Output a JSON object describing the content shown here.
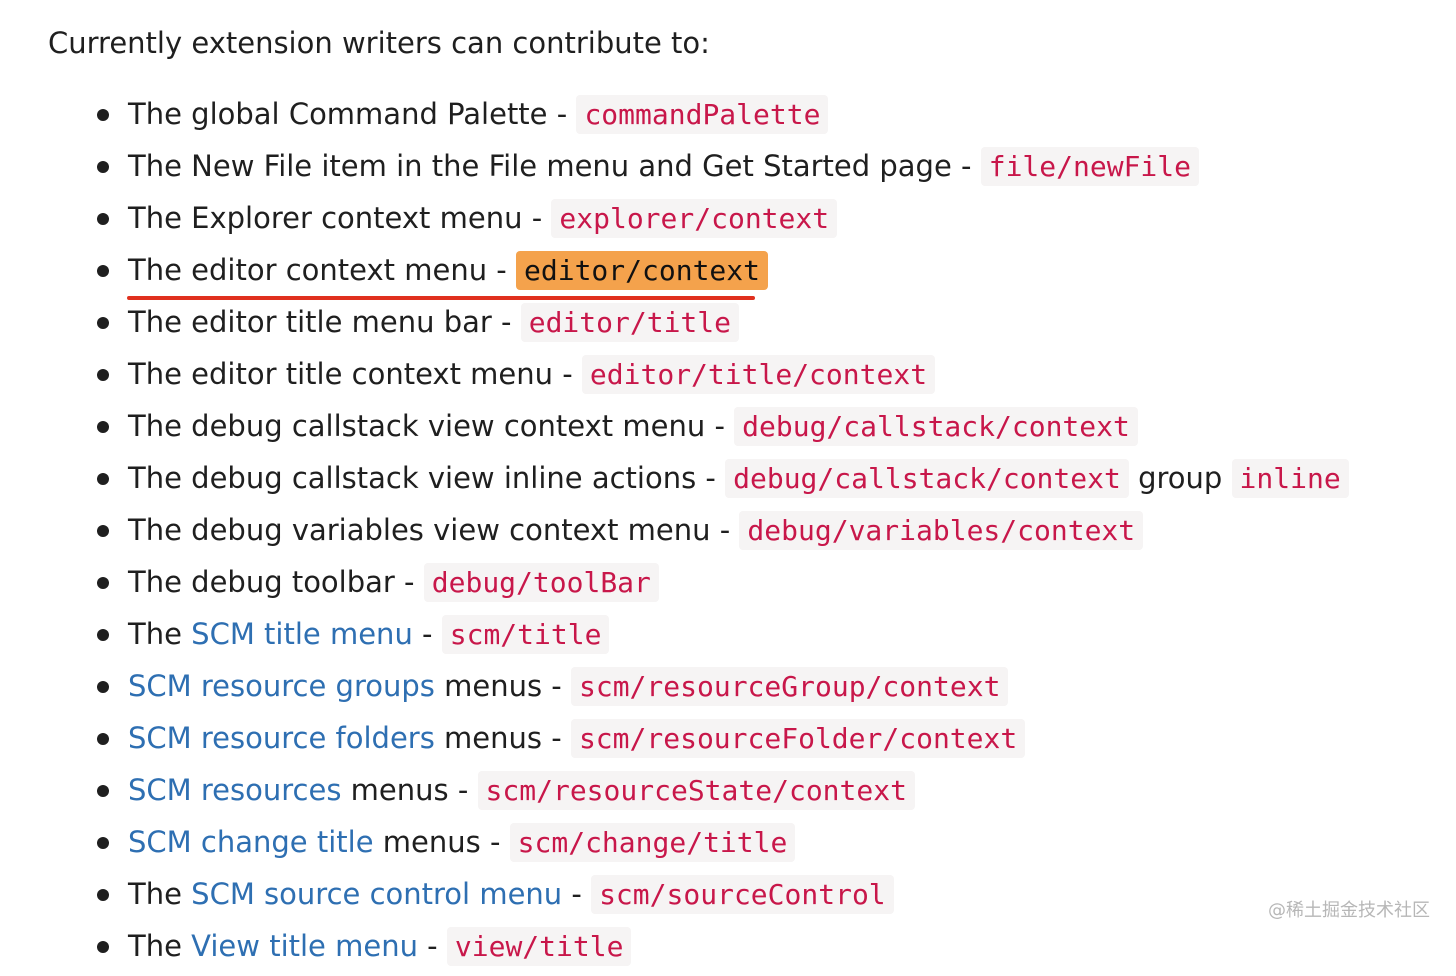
{
  "intro": "Currently extension writers can contribute to:",
  "items": [
    {
      "parts": [
        {
          "t": "text",
          "v": "The global Command Palette - "
        },
        {
          "t": "code",
          "v": "commandPalette"
        }
      ]
    },
    {
      "parts": [
        {
          "t": "text",
          "v": "The New File item in the File menu and Get Started page - "
        },
        {
          "t": "code",
          "v": "file/newFile"
        }
      ]
    },
    {
      "parts": [
        {
          "t": "text",
          "v": "The Explorer context menu - "
        },
        {
          "t": "code",
          "v": "explorer/context"
        }
      ]
    },
    {
      "emphasized": true,
      "parts": [
        {
          "t": "text",
          "v": "The editor context menu - "
        },
        {
          "t": "code-highlight",
          "v": "editor/context"
        }
      ]
    },
    {
      "parts": [
        {
          "t": "text",
          "v": "The editor title menu bar - "
        },
        {
          "t": "code",
          "v": "editor/title"
        }
      ]
    },
    {
      "parts": [
        {
          "t": "text",
          "v": "The editor title context menu - "
        },
        {
          "t": "code",
          "v": "editor/title/context"
        }
      ]
    },
    {
      "parts": [
        {
          "t": "text",
          "v": "The debug callstack view context menu - "
        },
        {
          "t": "code",
          "v": "debug/callstack/context"
        }
      ]
    },
    {
      "parts": [
        {
          "t": "text",
          "v": "The debug callstack view inline actions - "
        },
        {
          "t": "code",
          "v": "debug/callstack/context"
        },
        {
          "t": "text",
          "v": " group "
        },
        {
          "t": "code",
          "v": "inline"
        }
      ]
    },
    {
      "parts": [
        {
          "t": "text",
          "v": "The debug variables view context menu - "
        },
        {
          "t": "code",
          "v": "debug/variables/context"
        }
      ]
    },
    {
      "parts": [
        {
          "t": "text",
          "v": "The debug toolbar - "
        },
        {
          "t": "code",
          "v": "debug/toolBar"
        }
      ]
    },
    {
      "parts": [
        {
          "t": "text",
          "v": "The "
        },
        {
          "t": "link",
          "v": "SCM title menu"
        },
        {
          "t": "text",
          "v": " - "
        },
        {
          "t": "code",
          "v": "scm/title"
        }
      ]
    },
    {
      "parts": [
        {
          "t": "link",
          "v": "SCM resource groups"
        },
        {
          "t": "text",
          "v": " menus - "
        },
        {
          "t": "code",
          "v": "scm/resourceGroup/context"
        }
      ]
    },
    {
      "parts": [
        {
          "t": "link",
          "v": "SCM resource folders"
        },
        {
          "t": "text",
          "v": " menus - "
        },
        {
          "t": "code",
          "v": "scm/resourceFolder/context"
        }
      ]
    },
    {
      "parts": [
        {
          "t": "link",
          "v": "SCM resources"
        },
        {
          "t": "text",
          "v": " menus - "
        },
        {
          "t": "code",
          "v": "scm/resourceState/context"
        }
      ]
    },
    {
      "parts": [
        {
          "t": "link",
          "v": "SCM change title"
        },
        {
          "t": "text",
          "v": " menus - "
        },
        {
          "t": "code",
          "v": "scm/change/title"
        }
      ]
    },
    {
      "parts": [
        {
          "t": "text",
          "v": "The "
        },
        {
          "t": "link",
          "v": "SCM source control menu"
        },
        {
          "t": "text",
          "v": " - "
        },
        {
          "t": "code",
          "v": "scm/sourceControl"
        }
      ]
    },
    {
      "parts": [
        {
          "t": "text",
          "v": "The "
        },
        {
          "t": "link",
          "v": "View title menu"
        },
        {
          "t": "text",
          "v": " - "
        },
        {
          "t": "code",
          "v": "view/title"
        }
      ]
    }
  ],
  "watermark": "@稀土掘金技术社区",
  "colors": {
    "link": "#2e6fb2",
    "code_text": "#c8174a",
    "highlight": "#f4a24c",
    "underline": "#e0301e"
  }
}
